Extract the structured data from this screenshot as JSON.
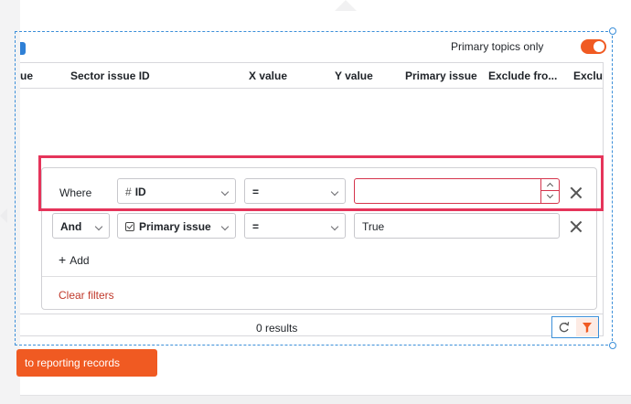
{
  "toolbar": {
    "toggle_label": "Primary topics only",
    "toggle_on": true
  },
  "table": {
    "columns": [
      "ue",
      "Sector issue ID",
      "X value",
      "Y value",
      "Primary issue",
      "Exclude fro...",
      "Exclu"
    ],
    "results_text": "0 results"
  },
  "filters": {
    "rows": [
      {
        "conjunction": "Where",
        "field": "ID",
        "field_type": "number",
        "operator": "=",
        "value": ""
      },
      {
        "conjunction": "And",
        "field": "Primary issue",
        "field_type": "checkbox",
        "operator": "=",
        "value": "True"
      }
    ],
    "add_label": "Add",
    "clear_label": "Clear filters"
  },
  "actions": {
    "primary_button_label": "to reporting records"
  },
  "colors": {
    "accent": "#f05a22",
    "highlight": "#e5345a",
    "selection": "#3b8fd9",
    "danger_text": "#c0392b"
  }
}
